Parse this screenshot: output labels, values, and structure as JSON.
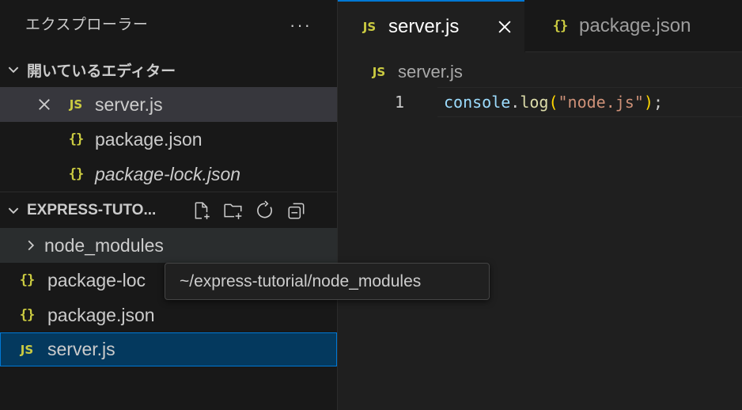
{
  "sidebar": {
    "title": "エクスプローラー",
    "more_actions": "···",
    "open_editors": {
      "header": "開いているエディター",
      "items": [
        {
          "icon": "JS",
          "label": "server.js"
        },
        {
          "icon": "{}",
          "label": "package.json"
        },
        {
          "icon": "{}",
          "label": "package-lock.json"
        }
      ]
    },
    "project": {
      "header": "EXPRESS-TUTO...",
      "items": [
        {
          "label": "node_modules"
        },
        {
          "icon": "{}",
          "label": "package-loc"
        },
        {
          "icon": "{}",
          "label": "package.json"
        },
        {
          "icon": "JS",
          "label": "server.js"
        }
      ]
    }
  },
  "tooltip": {
    "text": "~/express-tutorial/node_modules"
  },
  "tabs": [
    {
      "icon": "JS",
      "label": "server.js"
    },
    {
      "icon": "{}",
      "label": "package.json"
    }
  ],
  "editor": {
    "breadcrumb": {
      "icon": "JS",
      "label": "server.js"
    },
    "line_number": "1",
    "code": {
      "obj": "console",
      "dot": ".",
      "fn": "log",
      "open": "(",
      "str": "\"node.js\"",
      "close": ")",
      "semi": ";"
    }
  },
  "colors": {
    "accent": "#0078d4",
    "js_icon": "#cbcb41",
    "selection": "#04395e"
  }
}
